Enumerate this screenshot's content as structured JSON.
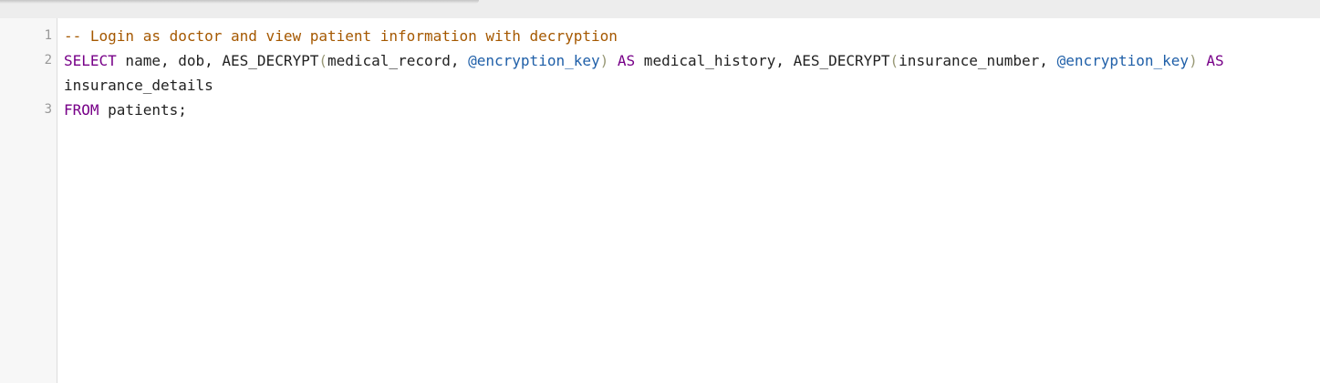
{
  "editor": {
    "lines": [
      {
        "number": "1",
        "tokens": [
          {
            "type": "comment",
            "text": "-- Login as doctor and view patient information with decryption"
          }
        ]
      },
      {
        "number": "2",
        "tokens": [
          {
            "type": "kw",
            "text": "SELECT"
          },
          {
            "type": "plain",
            "text": " name, dob, AES_DECRYPT"
          },
          {
            "type": "paren",
            "text": "("
          },
          {
            "type": "plain",
            "text": "medical_record, "
          },
          {
            "type": "var",
            "text": "@encryption_key"
          },
          {
            "type": "paren",
            "text": ")"
          },
          {
            "type": "plain",
            "text": " "
          },
          {
            "type": "kw",
            "text": "AS"
          },
          {
            "type": "plain",
            "text": " medical_history, AES_DECRYPT"
          },
          {
            "type": "paren",
            "text": "("
          },
          {
            "type": "plain",
            "text": "insurance_number, "
          },
          {
            "type": "var",
            "text": "@encryption_key"
          },
          {
            "type": "paren",
            "text": ")"
          },
          {
            "type": "plain",
            "text": " "
          },
          {
            "type": "kw",
            "text": "AS"
          },
          {
            "type": "plain",
            "text": " insurance_details"
          }
        ]
      },
      {
        "number": "3",
        "tokens": [
          {
            "type": "kw",
            "text": "FROM"
          },
          {
            "type": "plain",
            "text": " patients;"
          }
        ]
      }
    ]
  },
  "colors": {
    "comment": "#a55800",
    "keyword": "#770088",
    "variable": "#1f5fa8",
    "bracket": "#999977",
    "text": "#222222",
    "gutter_bg": "#f7f7f7",
    "line_number": "#999999"
  }
}
